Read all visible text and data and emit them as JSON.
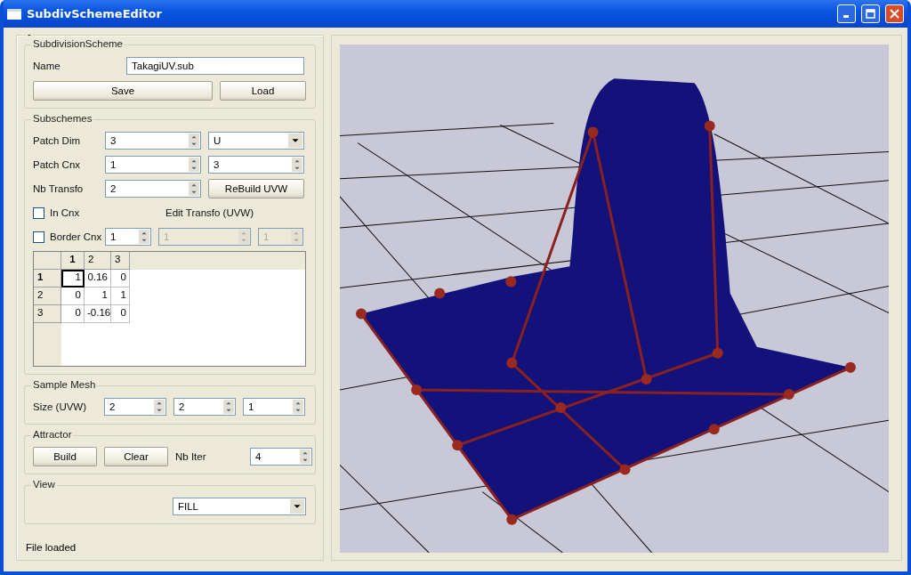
{
  "window": {
    "title": "SubdivSchemeEditor"
  },
  "panel": {
    "title": "-"
  },
  "subdivision_scheme": {
    "title": "SubdivisionScheme",
    "name_label": "Name",
    "name_value": "TakagiUV.sub",
    "buttons": [
      "Save",
      "Load"
    ]
  },
  "subschemes": {
    "title": "Subschemes",
    "patch_dim": {
      "label": "Patch Dim",
      "value": "3",
      "dropdown": "U"
    },
    "patch_cnx": {
      "label": "Patch Cnx",
      "values": [
        "1",
        "3"
      ]
    },
    "nb_transfo": {
      "label": "Nb Transfo",
      "value": "2",
      "button": "ReBuild UVW"
    },
    "in_cnx": {
      "label": "In Cnx",
      "checked": false
    },
    "edit_transfo_label": "Edit Transfo (UVW)",
    "border_cnx": {
      "label": "Border Cnx",
      "checked": false,
      "value": "1"
    },
    "edit_transfo": [
      {
        "value": "1",
        "disabled": true
      },
      {
        "value": "1",
        "disabled": true
      }
    ],
    "matrix": {
      "columns": [
        {
          "label": "1",
          "selected": true
        },
        {
          "label": "2",
          "selected": false
        },
        {
          "label": "3",
          "selected": false
        }
      ],
      "rows": [
        {
          "label": "1",
          "selected": true,
          "cells": [
            {
              "value": "1",
              "focused": true
            },
            {
              "value": "0.16",
              "focused": false
            },
            {
              "value": "0",
              "focused": false
            }
          ]
        },
        {
          "label": "2",
          "selected": false,
          "cells": [
            {
              "value": "0",
              "focused": false
            },
            {
              "value": "1",
              "focused": false
            },
            {
              "value": "1",
              "focused": false
            }
          ]
        },
        {
          "label": "3",
          "selected": false,
          "cells": [
            {
              "value": "0",
              "focused": false
            },
            {
              "value": "-0.16",
              "focused": false
            },
            {
              "value": "0",
              "focused": false
            }
          ]
        }
      ]
    }
  },
  "sample_mesh": {
    "title": "Sample Mesh",
    "label": "Size (UVW)",
    "values": [
      "2",
      "2",
      "1"
    ]
  },
  "attractor": {
    "title": "Attractor",
    "buttons": [
      "Build",
      "Clear"
    ],
    "iter_label": "Nb Iter",
    "iter_value": "4"
  },
  "view": {
    "title": "View",
    "mode": "FILL"
  },
  "status": "File loaded"
}
